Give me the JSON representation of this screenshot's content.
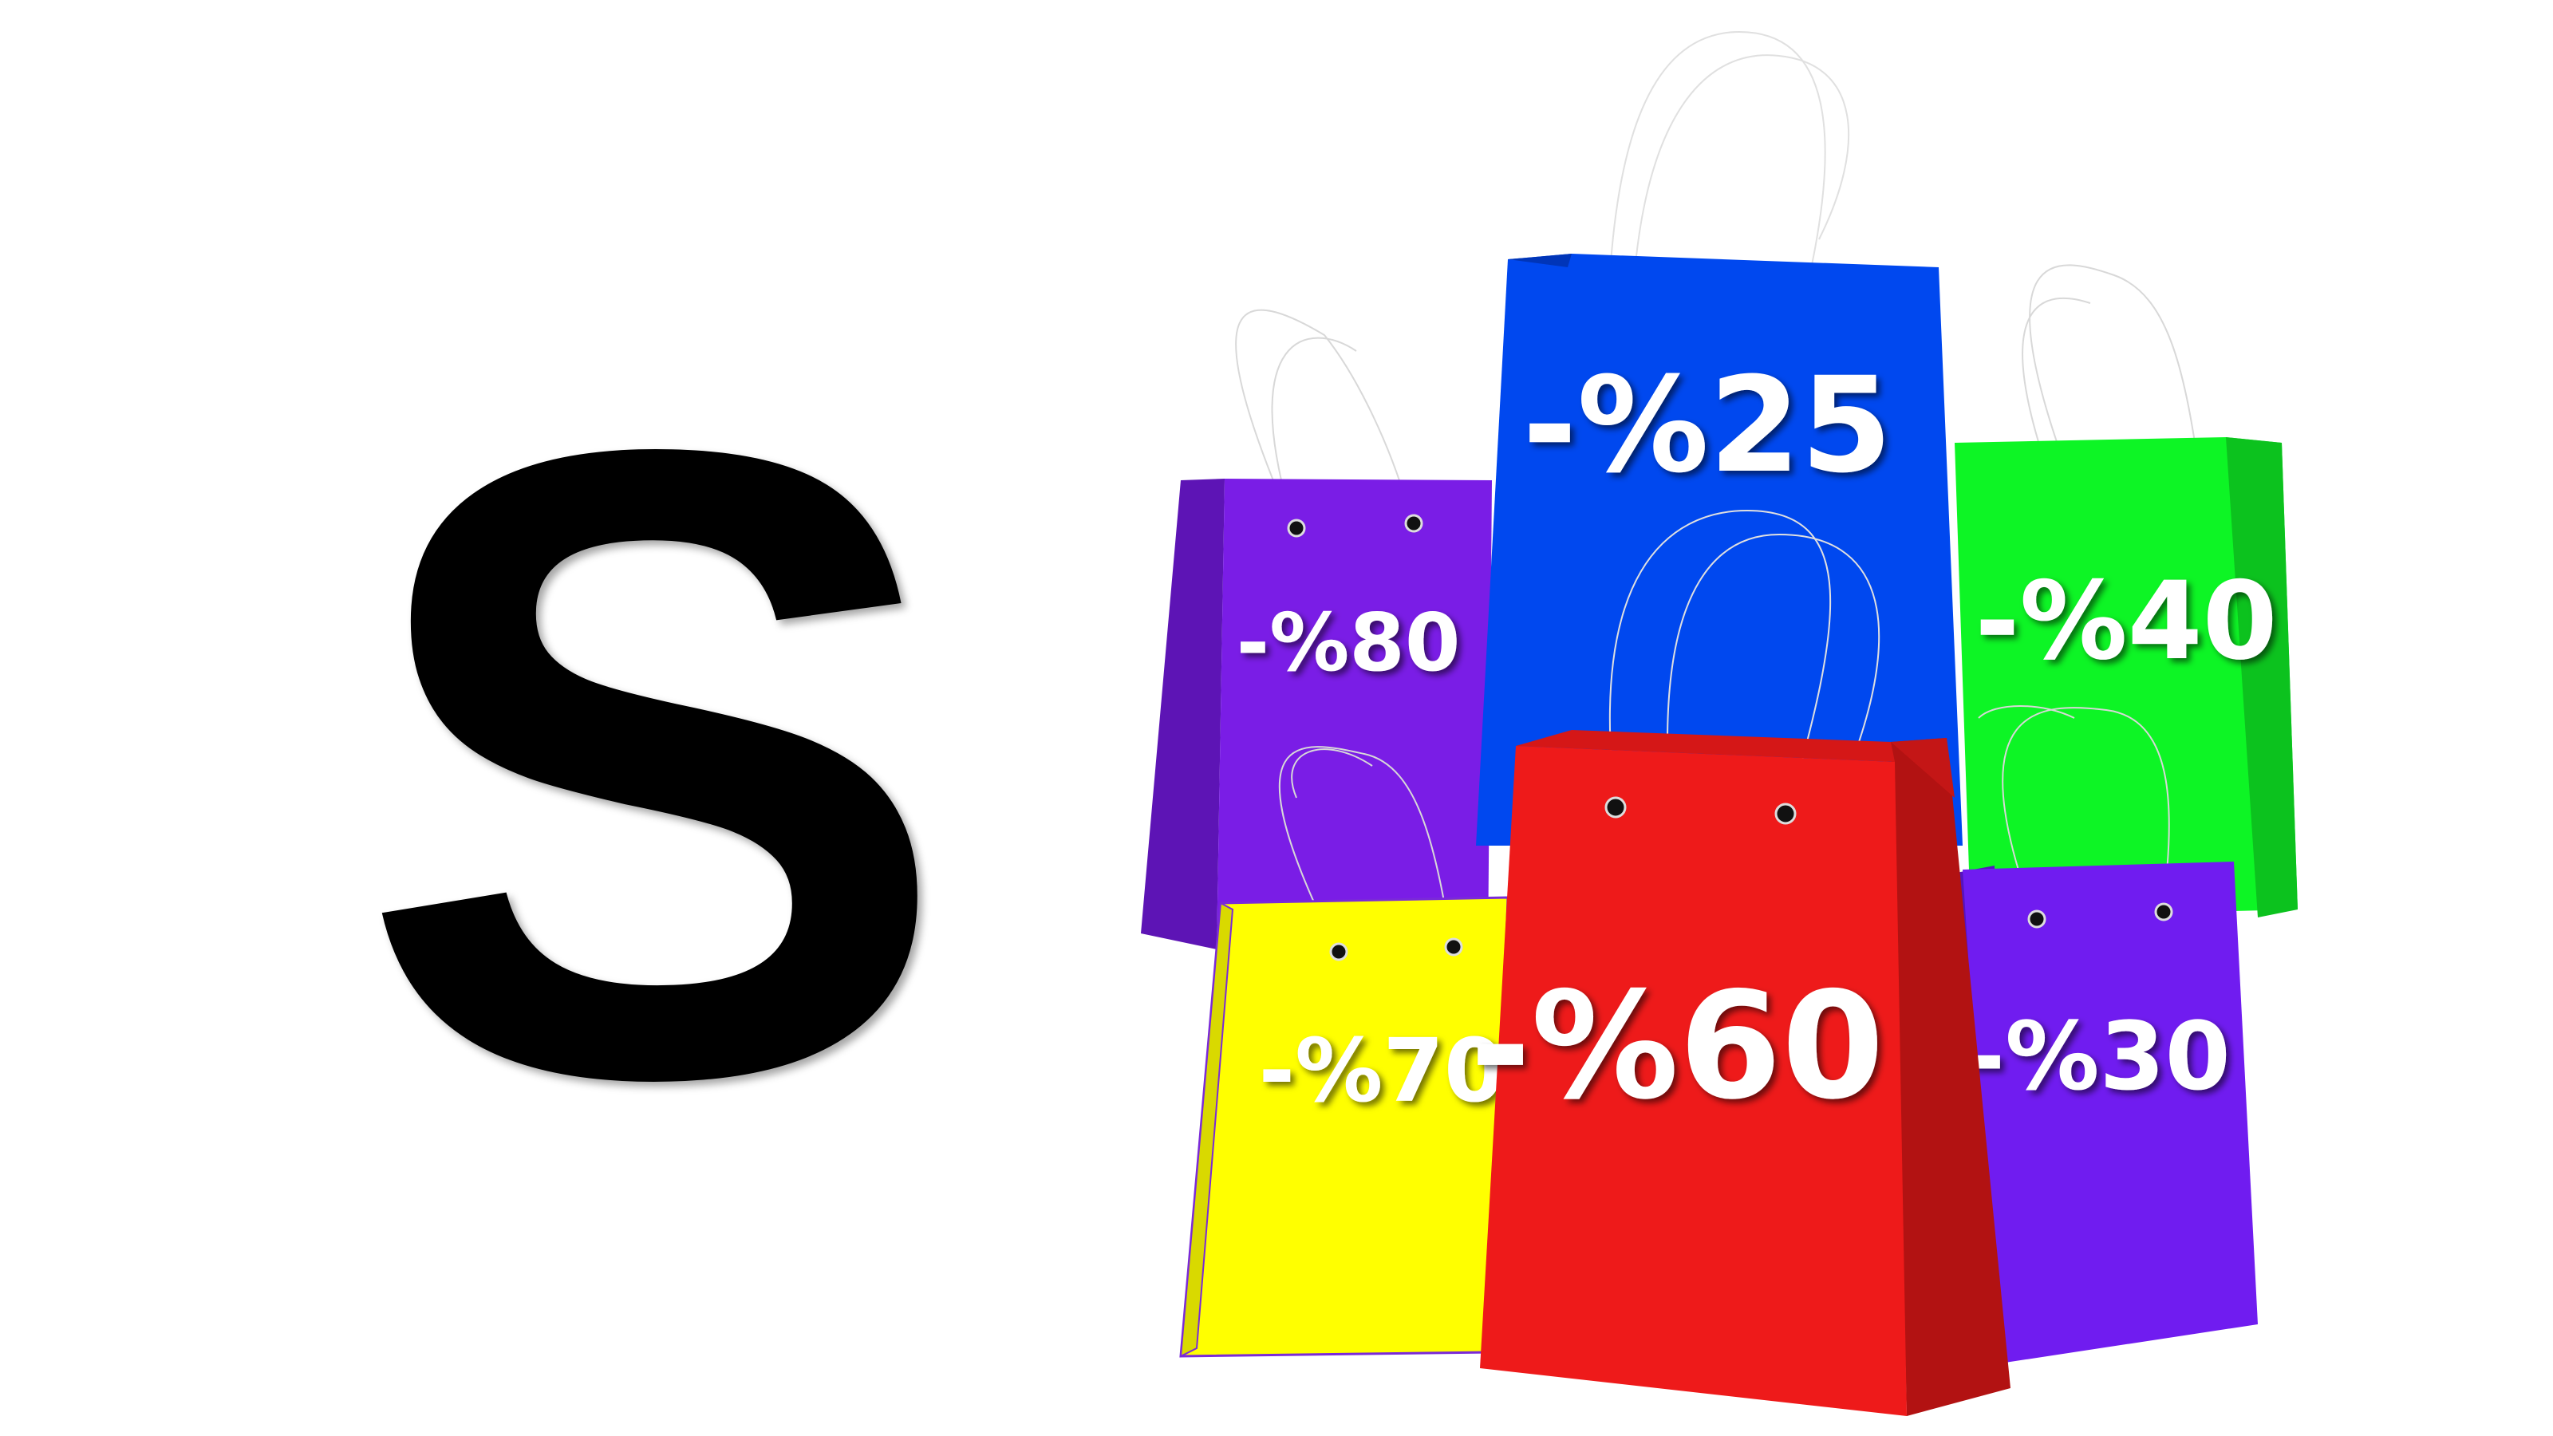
{
  "letter": "S",
  "colors": {
    "background": "#ffffff",
    "letter": "#000000",
    "price_text": "#ffffff",
    "handles": "#d8d8d8"
  },
  "bags": [
    {
      "id": "purple-back",
      "label": "-%80",
      "color": "#7a1de6",
      "shade": "#5d14b5"
    },
    {
      "id": "blue",
      "label": "-%25",
      "color": "#0048ef",
      "shade": "#0035b8"
    },
    {
      "id": "green",
      "label": "-%40",
      "color": "#0df525",
      "shade": "#0cc21e"
    },
    {
      "id": "yellow",
      "label": "-%70",
      "color": "#ffff00",
      "shade": "#d9d900"
    },
    {
      "id": "red",
      "label": "-%60",
      "color": "#ee1a1a",
      "shade": "#b21212"
    },
    {
      "id": "purple-front",
      "label": "-%30",
      "color": "#701cf0",
      "shade": "#5514bd"
    }
  ]
}
